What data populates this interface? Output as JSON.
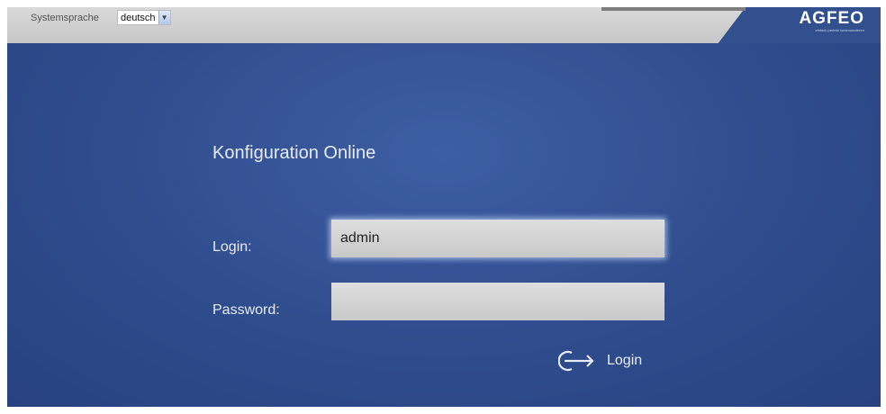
{
  "header": {
    "language_label": "Systemsprache",
    "language_value": "deutsch",
    "logo_text": "AGFEO",
    "logo_tagline": "einfach perfekt kommunizieren"
  },
  "login_form": {
    "title": "Konfiguration Online",
    "login_label": "Login:",
    "login_value": "admin",
    "password_label": "Password:",
    "password_value": "",
    "submit_label": "Login",
    "submit_icon": "login-arrow-icon"
  },
  "colors": {
    "background": "#2d4a8a",
    "header_bar": "#c9c9c9",
    "input_fill": "#d4d4d4",
    "text": "#e8ecf7"
  }
}
